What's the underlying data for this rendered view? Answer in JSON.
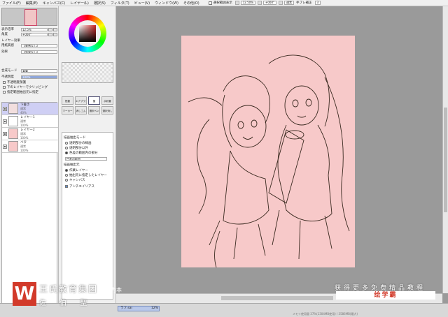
{
  "menu": [
    "ファイル(F)",
    "編集(E)",
    "キャンバス(C)",
    "レイヤー(L)",
    "選択(S)",
    "フィルタ(T)",
    "ビュー(V)",
    "ウィンドウ(W)",
    "その他(O)"
  ],
  "toolbar": {
    "selection_display": "選択範囲表示",
    "zoom": "12.50%",
    "rotation": "+000°",
    "mode": "通常",
    "stabilizer_label": "手ブレ補正",
    "stabilizer_value": "3"
  },
  "left_panel": {
    "zoom_label": "表示倍率",
    "zoom_value": "12.5%",
    "angle_label": "角度",
    "angle_value": "+000°",
    "layer_effect": "レイヤー効果",
    "texture_label": "用紙質感",
    "texture_value": "【質感なし】",
    "effect_label": "効果",
    "effect_value": "【効果なし】",
    "blend_label": "合成モード",
    "blend_value": "乗算",
    "opacity_label": "不透明度",
    "opacity_value": "100%",
    "preserve_opacity": "不透明度保護",
    "clipping": "下のレイヤーでクリッピング",
    "selection_source": "指定範囲抽出元に指定"
  },
  "layers": [
    {
      "name": "下書き",
      "mode": "通常",
      "opacity": "40%",
      "selected": true,
      "thumb": "#f2dede"
    },
    {
      "name": "レイヤー1",
      "mode": "通常",
      "opacity": "100%",
      "selected": false,
      "thumb": "#ffffff"
    },
    {
      "name": "レイヤー2",
      "mode": "通常",
      "opacity": "100%",
      "selected": false,
      "thumb": "#f7c9c9"
    },
    {
      "name": "ベタ",
      "mode": "通常",
      "opacity": "100%",
      "selected": false,
      "thumb": "#f7c9c9"
    }
  ],
  "tools": [
    "鉛筆",
    "エアブラシ",
    "筆",
    "水彩筆",
    "マーカー",
    "消しゴム",
    "選択ペン",
    "選択消し"
  ],
  "tool_props": {
    "section_mode": "描画抽出モード",
    "mode_options": [
      "透明部分の線画",
      "透明部分以外",
      "色差の範囲内の部分"
    ],
    "mode_selected": 2,
    "threshold_label": "色差の範囲",
    "section_source": "描画抽出元",
    "source_options": [
      "作業レイヤー",
      "抽出元に指定したレイヤー",
      "キャンバス"
    ],
    "source_selected": 0,
    "antialias": "アンチエイリアス"
  },
  "status": {
    "tab": "ラフ.sai",
    "zoom": "12%",
    "memory": "メモリ使用量 37%(1304MB使用) / 3586MB(最大)"
  },
  "watermark": {
    "logo_letter": "W",
    "brand": "王氏教育集团",
    "sub": "佐 伯 聖",
    "slogan": "人为本",
    "promo": "获得更多免费精品教程",
    "site": "绘学霸"
  },
  "colors": {
    "paper": "#f7c9c9",
    "selected_layer": "#cfcff4",
    "watermark_red": "#d23a2a"
  }
}
